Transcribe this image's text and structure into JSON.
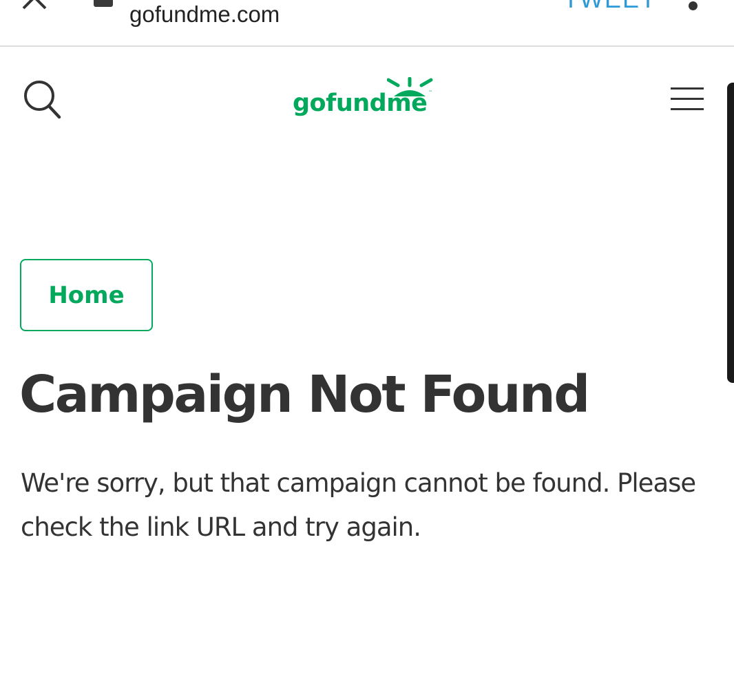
{
  "browser": {
    "url": "gofundme.com",
    "action_label": "TWEET",
    "icons": [
      "close-icon",
      "lock-icon",
      "more-vert-icon"
    ]
  },
  "header": {
    "logo_text": "gofundme",
    "logo_trademark": "™",
    "icons": [
      "search-icon",
      "hamburger-menu-icon"
    ]
  },
  "main": {
    "home_button": "Home",
    "title": "Campaign Not Found",
    "message": "We're sorry, but that campaign cannot be found. Please check the link URL and try again."
  },
  "colors": {
    "brand": "#02a95c",
    "text": "#333333",
    "link": "#2d9ad8"
  }
}
